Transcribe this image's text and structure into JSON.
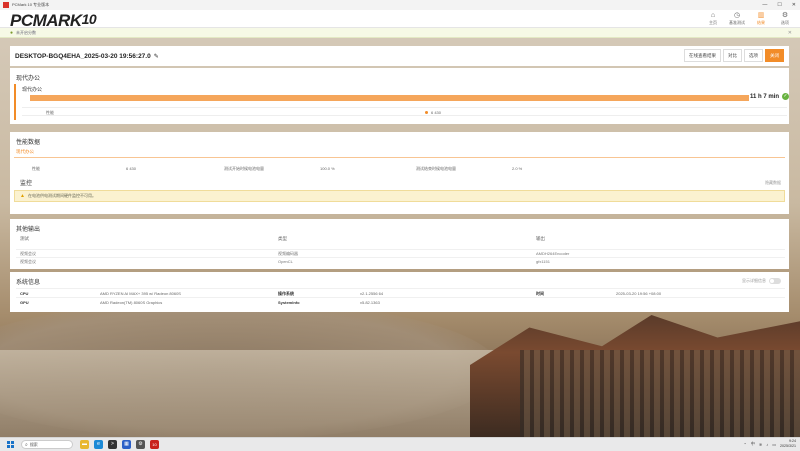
{
  "window": {
    "title": "PCMark 10 专业版本",
    "controls": [
      "—",
      "☐",
      "✕"
    ]
  },
  "header": {
    "logo_main": "PCMARK",
    "logo_num": "10",
    "nav": [
      {
        "label": "主页",
        "icon": "home-icon",
        "glyph": "⌂",
        "active": false
      },
      {
        "label": "基准测试",
        "icon": "stopwatch-icon",
        "glyph": "◷",
        "active": false
      },
      {
        "label": "结果",
        "icon": "bar-chart-icon",
        "glyph": "▥",
        "active": true
      },
      {
        "label": "选项",
        "icon": "gear-icon",
        "glyph": "⚙",
        "active": false
      }
    ]
  },
  "notice": {
    "text": "未开启分数"
  },
  "result": {
    "name": "DESKTOP-BGQ4EHA_2025-03-20 19:56:27.0",
    "actions": [
      "在线查看结果",
      "对比",
      "选项",
      "关闭"
    ]
  },
  "modern_office": {
    "title": "现代办公",
    "subtitle": "现代办公",
    "duration": "11 h 7 min",
    "score_label": "性能",
    "score_value": "6 430"
  },
  "performance": {
    "title": "性能数据",
    "tab": "现代办公",
    "row": [
      "性能",
      "6 430",
      "测试开始时候电池电量",
      "100.0 %",
      "测试结束时候电池电量",
      "2.0 %"
    ],
    "monitor_title": "监控",
    "monitor_link": "隐藏数据",
    "warning": "在电池供电测试期间硬件监控不可用。"
  },
  "other_outputs": {
    "title": "其他输出",
    "columns": [
      "测试",
      "类型",
      "输出"
    ],
    "rows": [
      [
        "视频会议",
        "视频编码器",
        "AMDH264Encoder"
      ],
      [
        "视频会议",
        "OpenCL",
        "gfx1151"
      ]
    ]
  },
  "system_info": {
    "title": "系统信息",
    "toggle_label": "显示详细信息",
    "rows": [
      [
        "CPU",
        "AMD RYZEN AI MAX+ 395 w/ Radeon 8060S",
        "操作系统",
        "v2.1.2556 64",
        "时间",
        "2025-03-20 19:56 +08:00"
      ],
      [
        "GPU",
        "AMD Radeon(TM) 8060S Graphics",
        "SystemInfo",
        "v5.82.1363",
        "",
        ""
      ]
    ]
  },
  "taskbar": {
    "search_placeholder": "搜索",
    "apps": [
      {
        "name": "file-explorer-icon",
        "color": "#e8b730",
        "glyph": "▬"
      },
      {
        "name": "edge-browser-icon",
        "color": "#1c8ad6",
        "glyph": "e"
      },
      {
        "name": "terminal-icon",
        "color": "#333333",
        "glyph": ">"
      },
      {
        "name": "store-icon",
        "color": "#2b5fc7",
        "glyph": "▦"
      },
      {
        "name": "settings-icon",
        "color": "#555555",
        "glyph": "⚙"
      },
      {
        "name": "pcmark-taskbar-icon",
        "color": "#c8231d",
        "glyph": "10"
      }
    ],
    "ime": "中",
    "time": "9:24",
    "date": "2025/3/21"
  },
  "colors": {
    "accent": "#f28c28",
    "bar": "#f5a65b",
    "ok": "#67b23f"
  }
}
